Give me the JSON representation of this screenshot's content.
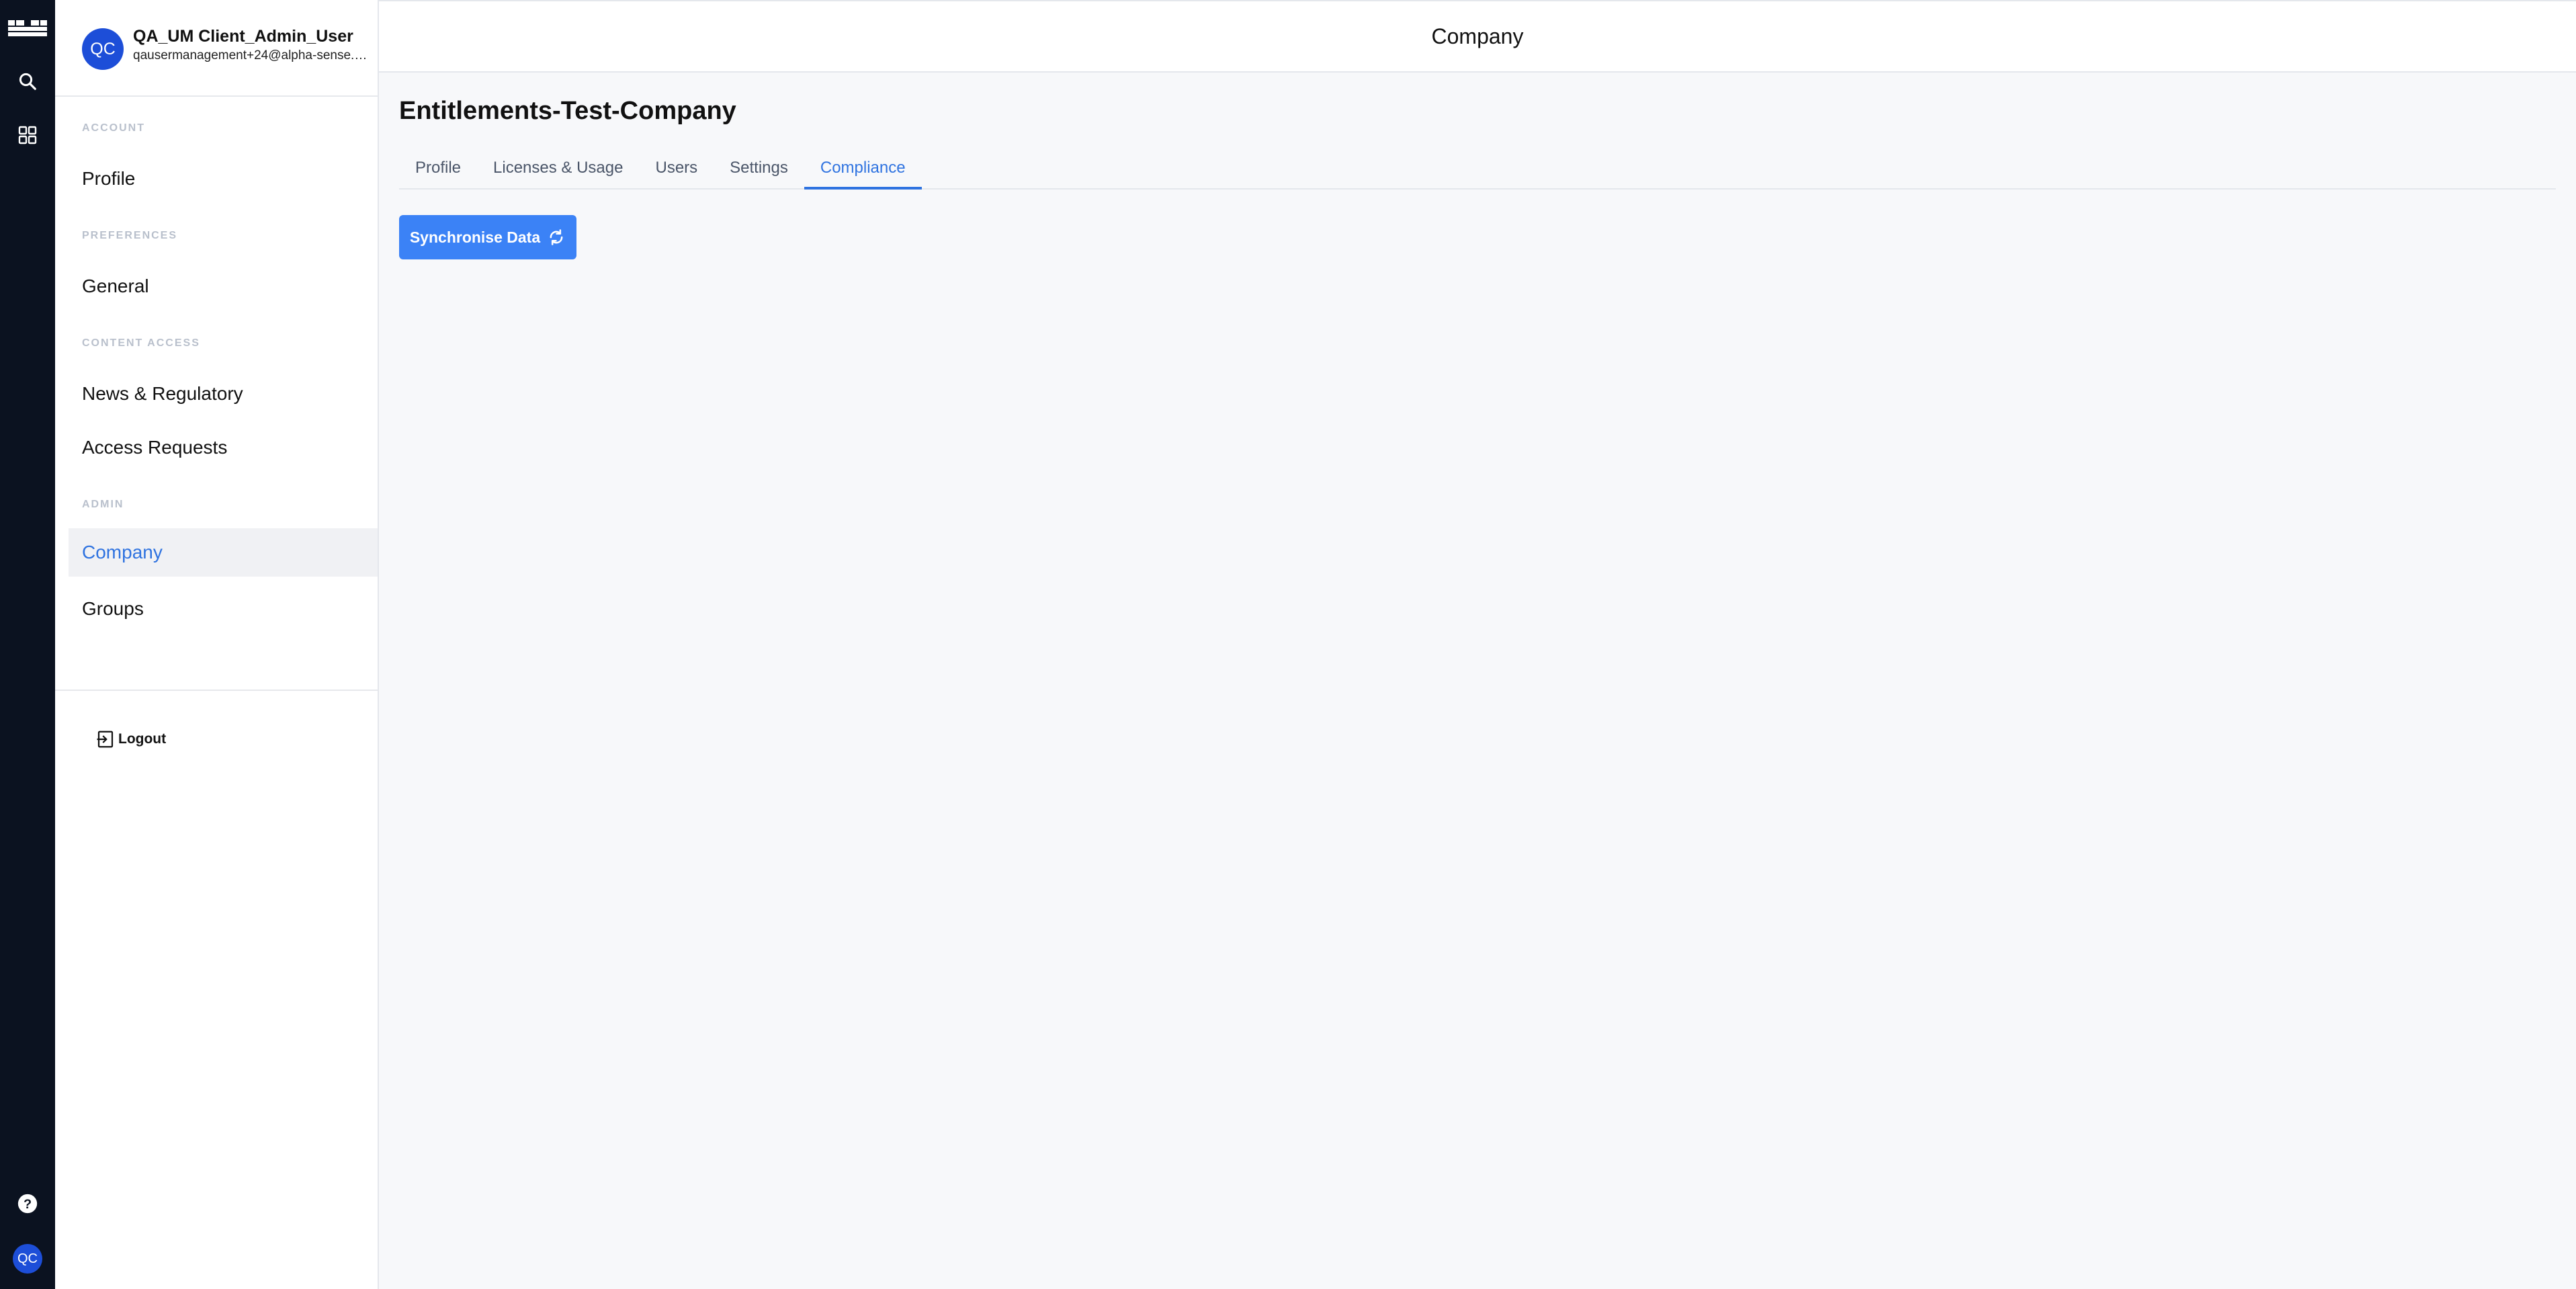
{
  "rail": {
    "avatar_initials": "QC"
  },
  "user": {
    "initials": "QC",
    "name": "QA_UM Client_Admin_User",
    "email": "qausermanagement+24@alpha-sense.com"
  },
  "sidebar": {
    "sections": {
      "account": "ACCOUNT",
      "preferences": "PREFERENCES",
      "content_access": "CONTENT ACCESS",
      "admin": "ADMIN"
    },
    "items": {
      "profile": "Profile",
      "general": "General",
      "news_regulatory": "News & Regulatory",
      "access_requests": "Access Requests",
      "company": "Company",
      "groups": "Groups"
    },
    "logout_label": "Logout"
  },
  "header": {
    "title": "Company"
  },
  "main": {
    "company_name": "Entitlements-Test-Company",
    "tabs": {
      "profile": "Profile",
      "licenses_usage": "Licenses & Usage",
      "users": "Users",
      "settings": "Settings",
      "compliance": "Compliance"
    },
    "active_tab": "compliance",
    "sync_button_label": "Synchronise Data"
  },
  "colors": {
    "accent": "#2f73e0",
    "button": "#3b82f6",
    "rail": "#0b1220",
    "avatar": "#1d4ed8"
  }
}
